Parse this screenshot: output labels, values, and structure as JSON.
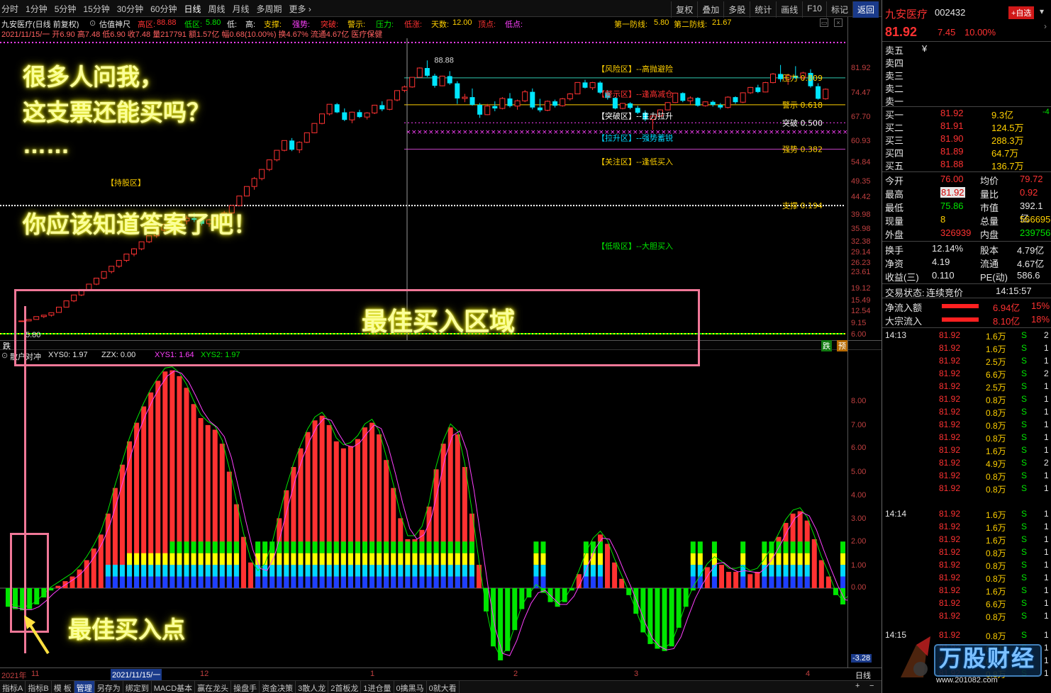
{
  "toolbar": {
    "periods": [
      "分时",
      "1分钟",
      "5分钟",
      "15分钟",
      "30分钟",
      "60分钟",
      "日线",
      "周线",
      "月线",
      "多周期",
      "更多 ›"
    ],
    "active": "日线",
    "right": [
      "复权",
      "叠加",
      "多股",
      "统计",
      "画线",
      "F10",
      "标记",
      "返回"
    ]
  },
  "info": {
    "line1_title": "九安医疗(日线 前复权)",
    "indicator": "估值神尺",
    "high_zone_label": "高区:",
    "high_zone": "88.88",
    "low_zone_label": "低区:",
    "low_zone": "5.80",
    "low_label": "低:",
    "high_label": "高:",
    "support_label": "支撑:",
    "strong_label": "强势:",
    "break_label": "突破:",
    "warn_label": "警示:",
    "pressure_label": "压力:",
    "lowrise_label": "低涨:",
    "days_label": "天数:",
    "days": "12.00",
    "top_label": "顶点:",
    "bottom_label": "低点:",
    "line2": "2021/11/15/一 开6.90 高7.48 低6.90 收7.48 量217791 额1.57亿 幅0.68(10.00%) 换4.67% 流通4.67亿 医疗保健",
    "defense1_label": "第一防线:",
    "defense1": "5.80",
    "defense2_label": "第二防线:",
    "defense2": "21.67"
  },
  "scale_main": [
    "81.92",
    "74.47",
    "67.70",
    "60.93",
    "54.84",
    "49.35",
    "44.42",
    "39.98",
    "35.98",
    "32.38",
    "29.14",
    "26.23",
    "23.61",
    "19.12",
    "15.49",
    "12.54",
    "9.15",
    "6.00"
  ],
  "scale_sub": [
    "8.00",
    "7.00",
    "6.00",
    "5.00",
    "4.00",
    "3.00",
    "2.00",
    "1.00",
    "0.00",
    "-3.28"
  ],
  "zones": {
    "risk": "【风险区】--高抛避险",
    "warn": "【警示区】--逢高减仓",
    "break": "【突破区】--主力拉升",
    "lift": "【拉升区】--强势蓄锐",
    "focus": "【关注区】--逢低买入",
    "lowbuy": "【低吸区】--大胆买入",
    "hold": "【持股区】"
  },
  "levels": {
    "pressure": "压力 0.809",
    "warn": "警示 0.618",
    "break": "突破 0.500",
    "strong": "强势 0.382",
    "support": "支撑 0.194",
    "high_mark": "88.88",
    "low_mark": "5.80"
  },
  "subind": {
    "name": "散户对冲",
    "xys0": "XYS0: 1.97",
    "zzx": "ZZX: 0.00",
    "xys1": "XYS1: 1.64",
    "xys2": "XYS2: 1.97"
  },
  "divider": {
    "fall": "跌",
    "pre": "预"
  },
  "dates": {
    "year": "2021年",
    "m11": "11",
    "cursor": "2021/11/15/一",
    "m12": "12",
    "m1": "1",
    "m2": "2",
    "m3": "3",
    "m4": "4",
    "period": "日线"
  },
  "bottom_tabs": [
    "指标A",
    "指标B",
    "模 板",
    "管理",
    "另存为",
    "绑定到",
    "MACD基本",
    "赢在龙头",
    "操盘手",
    "资金决策",
    "3散人龙",
    "2首板龙",
    "1进仓量",
    "0擒黑马",
    "0就大看"
  ],
  "bottom_active": "管理",
  "overlay": {
    "q1": "很多人问我，",
    "q2": "这支票还能买吗？",
    "q3": "……",
    "q4": "你应该知道答案了吧！",
    "zone": "最佳买入区域",
    "point": "最佳买入点"
  },
  "stock": {
    "name": "九安医疗",
    "code": "002432",
    "fav": "+自选",
    "price": "81.92",
    "change": "7.45",
    "pct": "10.00%"
  },
  "asks": [
    [
      "卖五",
      "¥"
    ],
    [
      "卖四",
      ""
    ],
    [
      "卖三",
      ""
    ],
    [
      "卖二",
      ""
    ],
    [
      "卖一",
      ""
    ]
  ],
  "bids": [
    [
      "买一",
      "81.92",
      "9.3亿",
      "-4"
    ],
    [
      "买二",
      "81.91",
      "124.5万",
      ""
    ],
    [
      "买三",
      "81.90",
      "288.3万",
      ""
    ],
    [
      "买四",
      "81.89",
      "64.7万",
      ""
    ],
    [
      "买五",
      "81.88",
      "136.7万",
      ""
    ]
  ],
  "quote": [
    [
      "今开",
      "76.00",
      "均价",
      "79.72"
    ],
    [
      "最高",
      "81.92",
      "量比",
      "0.92"
    ],
    [
      "最低",
      "75.86",
      "市值",
      "392.1亿"
    ],
    [
      "现量",
      "8",
      "总量",
      "566695"
    ],
    [
      "外盘",
      "326939",
      "内盘",
      "239756"
    ]
  ],
  "stats": [
    [
      "换手",
      "12.14%",
      "股本",
      "4.79亿"
    ],
    [
      "净资",
      "4.19",
      "流通",
      "4.67亿"
    ],
    [
      "收益(三)",
      "0.110",
      "PE(动)",
      "586.6"
    ]
  ],
  "trade_state": {
    "label": "交易状态:",
    "value": "连续竞价",
    "time": "14:15:57"
  },
  "flows": [
    {
      "label": "净流入额",
      "value": "6.94亿",
      "pct": "15%"
    },
    {
      "label": "大宗流入",
      "value": "8.10亿",
      "pct": "18%"
    }
  ],
  "ticks": [
    {
      "t": "14:13",
      "p": "81.92",
      "v": "1.6万",
      "s": "S",
      "n": "2"
    },
    {
      "t": "",
      "p": "81.92",
      "v": "1.6万",
      "s": "S",
      "n": "1"
    },
    {
      "t": "",
      "p": "81.92",
      "v": "2.5万",
      "s": "S",
      "n": "1"
    },
    {
      "t": "",
      "p": "81.92",
      "v": "6.6万",
      "s": "S",
      "n": "2"
    },
    {
      "t": "",
      "p": "81.92",
      "v": "2.5万",
      "s": "S",
      "n": "1"
    },
    {
      "t": "",
      "p": "81.92",
      "v": "0.8万",
      "s": "S",
      "n": "1"
    },
    {
      "t": "",
      "p": "81.92",
      "v": "0.8万",
      "s": "S",
      "n": "1"
    },
    {
      "t": "",
      "p": "81.92",
      "v": "0.8万",
      "s": "S",
      "n": "1"
    },
    {
      "t": "",
      "p": "81.92",
      "v": "0.8万",
      "s": "S",
      "n": "1"
    },
    {
      "t": "",
      "p": "81.92",
      "v": "1.6万",
      "s": "S",
      "n": "1"
    },
    {
      "t": "",
      "p": "81.92",
      "v": "4.9万",
      "s": "S",
      "n": "2"
    },
    {
      "t": "",
      "p": "81.92",
      "v": "0.8万",
      "s": "S",
      "n": "1"
    },
    {
      "t": "",
      "p": "81.92",
      "v": "0.8万",
      "s": "S",
      "n": "1"
    },
    {
      "t": "14:14",
      "p": "81.92",
      "v": "1.6万",
      "s": "S",
      "n": "1"
    },
    {
      "t": "",
      "p": "81.92",
      "v": "1.6万",
      "s": "S",
      "n": "1"
    },
    {
      "t": "",
      "p": "81.92",
      "v": "1.6万",
      "s": "S",
      "n": "1"
    },
    {
      "t": "",
      "p": "81.92",
      "v": "0.8万",
      "s": "S",
      "n": "1"
    },
    {
      "t": "",
      "p": "81.92",
      "v": "0.8万",
      "s": "S",
      "n": "1"
    },
    {
      "t": "",
      "p": "81.92",
      "v": "0.8万",
      "s": "S",
      "n": "1"
    },
    {
      "t": "",
      "p": "81.92",
      "v": "1.6万",
      "s": "S",
      "n": "1"
    },
    {
      "t": "",
      "p": "81.92",
      "v": "6.6万",
      "s": "S",
      "n": "1"
    },
    {
      "t": "",
      "p": "81.92",
      "v": "0.8万",
      "s": "S",
      "n": "1"
    },
    {
      "t": "14:15",
      "p": "81.92",
      "v": "0.8万",
      "s": "S",
      "n": "1"
    },
    {
      "t": "",
      "p": "81.92",
      "v": "0.8万",
      "s": "S",
      "n": "1"
    },
    {
      "t": "",
      "p": "81.92",
      "v": "0.8万",
      "s": "S",
      "n": "1"
    },
    {
      "t": "",
      "p": "81.92",
      "v": "0.8万",
      "s": "S",
      "n": "1"
    }
  ],
  "watermark": {
    "text": "万股财经",
    "url": "www.201082.com"
  },
  "colors": {
    "up": "#ff3232",
    "down": "#00e6ff",
    "green": "#00e600",
    "yellow": "#ffd000",
    "annotation": "#f07898"
  },
  "candles": [
    [
      6.9,
      6.9,
      6.9,
      6.9
    ],
    [
      6.9,
      7.0,
      6.9,
      7.0
    ],
    [
      7.0,
      7.2,
      7.0,
      7.2
    ],
    [
      7.2,
      7.3,
      7.1,
      7.3
    ],
    [
      7.3,
      7.5,
      7.2,
      7.48
    ],
    [
      7.5,
      7.9,
      7.5,
      7.9
    ],
    [
      7.9,
      8.4,
      7.9,
      8.4
    ],
    [
      8.4,
      8.9,
      8.3,
      8.9
    ],
    [
      8.9,
      9.4,
      8.8,
      9.4
    ],
    [
      9.4,
      9.9,
      9.3,
      9.9
    ],
    [
      9.9,
      10.5,
      9.8,
      10.5
    ],
    [
      10.5,
      11.2,
      10.4,
      11.2
    ],
    [
      11.2,
      11.8,
      11.0,
      11.8
    ],
    [
      11.8,
      12.5,
      11.6,
      12.5
    ],
    [
      12.5,
      13.3,
      12.3,
      13.3
    ],
    [
      13.3,
      14.1,
      13.0,
      14.0
    ],
    [
      14.0,
      15.0,
      13.8,
      15.0
    ],
    [
      15.0,
      15.9,
      14.8,
      15.9
    ],
    [
      15.9,
      16.9,
      15.6,
      16.8
    ],
    [
      16.8,
      17.9,
      16.5,
      17.8
    ],
    [
      17.8,
      18.8,
      17.2,
      17.4
    ],
    [
      17.4,
      18.5,
      16.9,
      18.4
    ],
    [
      18.4,
      19.4,
      17.8,
      18.9
    ],
    [
      18.9,
      19.9,
      18.2,
      18.6
    ],
    [
      18.6,
      19.6,
      17.6,
      17.9
    ],
    [
      17.9,
      18.8,
      17.4,
      18.6
    ],
    [
      18.6,
      19.6,
      18.0,
      19.3
    ],
    [
      19.3,
      20.3,
      18.8,
      19.9
    ],
    [
      19.9,
      21.5,
      19.6,
      21.4
    ],
    [
      21.4,
      23.5,
      21.3,
      23.5
    ],
    [
      23.5,
      25.8,
      23.4,
      25.8
    ],
    [
      25.8,
      28.3,
      25.0,
      27.9
    ],
    [
      27.9,
      30.6,
      27.4,
      30.5
    ],
    [
      30.5,
      33.6,
      30.0,
      33.5
    ],
    [
      33.5,
      36.8,
      33.0,
      36.8
    ],
    [
      36.8,
      40.5,
      36.4,
      40.5
    ],
    [
      40.5,
      41.5,
      36.5,
      37.0
    ],
    [
      37.0,
      40.2,
      35.8,
      39.8
    ],
    [
      39.8,
      43.8,
      39.5,
      43.7
    ],
    [
      43.7,
      48.0,
      43.5,
      47.9
    ],
    [
      47.9,
      52.6,
      47.5,
      52.6
    ],
    [
      52.6,
      57.8,
      51.8,
      57.8
    ],
    [
      57.8,
      58.5,
      53.0,
      53.4
    ],
    [
      53.4,
      55.5,
      49.0,
      49.6
    ],
    [
      49.6,
      53.8,
      48.0,
      53.5
    ],
    [
      53.5,
      54.8,
      50.5,
      51.0
    ],
    [
      51.0,
      53.5,
      49.8,
      53.1
    ],
    [
      53.1,
      57.5,
      52.5,
      57.3
    ],
    [
      57.3,
      59.5,
      54.0,
      55.0
    ],
    [
      55.0,
      60.5,
      54.5,
      60.3
    ],
    [
      60.3,
      66.3,
      59.5,
      66.1
    ],
    [
      66.3,
      69.5,
      65.0,
      68.5
    ],
    [
      68.5,
      75.4,
      68.0,
      75.3
    ],
    [
      75.3,
      83.0,
      75.0,
      82.5
    ],
    [
      82.5,
      88.88,
      75.5,
      76.5
    ],
    [
      76.5,
      78.0,
      68.0,
      69.3
    ],
    [
      69.3,
      76.5,
      69.0,
      76.2
    ],
    [
      76.2,
      80.0,
      70.0,
      71.0
    ],
    [
      71.0,
      72.5,
      58.0,
      61.2
    ],
    [
      61.2,
      64.0,
      59.0,
      62.0
    ],
    [
      62.0,
      67.5,
      57.0,
      57.5
    ],
    [
      57.5,
      58.5,
      50.6,
      52.2
    ],
    [
      52.2,
      58.0,
      52.0,
      56.8
    ],
    [
      56.8,
      59.5,
      54.0,
      55.5
    ],
    [
      55.5,
      62.0,
      55.0,
      61.2
    ],
    [
      61.2,
      64.5,
      56.0,
      56.8
    ],
    [
      56.8,
      60.5,
      54.8,
      59.8
    ],
    [
      59.8,
      66.5,
      59.0,
      65.3
    ],
    [
      65.3,
      67.5,
      55.0,
      56.0
    ],
    [
      56.0,
      61.0,
      53.5,
      54.5
    ],
    [
      54.5,
      60.0,
      54.0,
      59.5
    ],
    [
      59.5,
      60.5,
      56.0,
      57.0
    ],
    [
      57.0,
      61.5,
      56.5,
      61.0
    ],
    [
      61.0,
      64.5,
      60.0,
      64.0
    ],
    [
      64.0,
      71.8,
      64.0,
      71.6
    ],
    [
      71.6,
      73.5,
      67.5,
      68.0
    ],
    [
      68.0,
      72.0,
      66.5,
      71.5
    ],
    [
      71.5,
      72.5,
      64.0,
      64.8
    ],
    [
      64.8,
      66.5,
      60.5,
      61.5
    ],
    [
      61.5,
      62.0,
      55.0,
      55.5
    ],
    [
      55.5,
      58.5,
      55.0,
      58.3
    ],
    [
      58.3,
      59.0,
      55.0,
      55.8
    ],
    [
      55.8,
      57.0,
      52.5,
      53.2
    ],
    [
      53.2,
      54.5,
      49.0,
      49.8
    ],
    [
      49.8,
      52.0,
      45.0,
      51.5
    ],
    [
      51.5,
      55.0,
      51.0,
      54.7
    ],
    [
      54.7,
      59.0,
      54.5,
      58.8
    ],
    [
      58.8,
      64.8,
      58.5,
      64.5
    ],
    [
      64.5,
      65.0,
      59.0,
      59.8
    ],
    [
      59.8,
      62.5,
      57.5,
      61.5
    ],
    [
      61.5,
      62.0,
      56.5,
      57.0
    ],
    [
      57.0,
      59.5,
      56.5,
      59.2
    ],
    [
      59.2,
      60.0,
      56.5,
      57.5
    ],
    [
      57.5,
      58.5,
      55.0,
      56.0
    ],
    [
      56.0,
      62.5,
      55.5,
      62.0
    ],
    [
      62.0,
      62.5,
      58.0,
      59.0
    ],
    [
      59.0,
      65.0,
      58.5,
      64.7
    ],
    [
      64.7,
      68.5,
      64.0,
      68.2
    ],
    [
      68.2,
      70.0,
      64.5,
      65.2
    ],
    [
      65.2,
      72.0,
      65.0,
      71.5
    ],
    [
      71.5,
      78.6,
      71.0,
      77.8
    ],
    [
      77.8,
      85.0,
      72.0,
      74.0
    ],
    [
      74.0,
      78.0,
      70.0,
      76.5
    ],
    [
      76.5,
      84.0,
      74.0,
      75.0
    ],
    [
      75.0,
      79.5,
      73.5,
      78.6
    ],
    [
      78.6,
      81.5,
      68.0,
      69.0
    ],
    [
      69.0,
      71.0,
      60.5,
      61.0
    ],
    [
      61.0,
      67.5,
      60.5,
      67.0
    ]
  ],
  "osc": [
    -0.8,
    -0.9,
    -0.95,
    -0.9,
    -0.7,
    -0.4,
    -0.1,
    0.1,
    0.3,
    0.5,
    0.8,
    1.2,
    1.7,
    2.3,
    3.2,
    4.3,
    5.3,
    6.3,
    7.1,
    7.8,
    8.4,
    8.9,
    9.3,
    9.35,
    9.1,
    8.6,
    7.9,
    7.3,
    7.0,
    6.8,
    6.2,
    5.0,
    3.6,
    2.2,
    1.1,
    0.6,
    0.9,
    1.8,
    3.0,
    4.2,
    5.2,
    6.0,
    6.7,
    7.2,
    7.4,
    7.0,
    6.3,
    6.0,
    6.1,
    6.4,
    6.9,
    7.1,
    6.6,
    5.5,
    4.3,
    3.0,
    2.1,
    2.1,
    2.5,
    3.5,
    5.1,
    6.2,
    6.9,
    6.6,
    5.2,
    3.2,
    1.0,
    -1.0,
    -2.5,
    -3.1,
    -2.7,
    -1.8,
    -0.9,
    -0.4,
    0.0,
    -0.2,
    -0.6,
    -0.8,
    -0.6,
    -0.1,
    0.6,
    1.4,
    2.0,
    2.3,
    1.9,
    1.1,
    0.4,
    -0.3,
    -1.1,
    -1.9,
    -2.4,
    -2.6,
    -2.7,
    -2.5,
    -1.7,
    -0.8,
    -0.1,
    0.4,
    0.9,
    1.2,
    1.0,
    0.7,
    0.7,
    0.8,
    0.6,
    0.7,
    1.1,
    1.6,
    2.2,
    2.8,
    3.2,
    3.3,
    2.9,
    2.1,
    1.2,
    0.5,
    -0.3,
    -0.7,
    -0.4
  ]
}
